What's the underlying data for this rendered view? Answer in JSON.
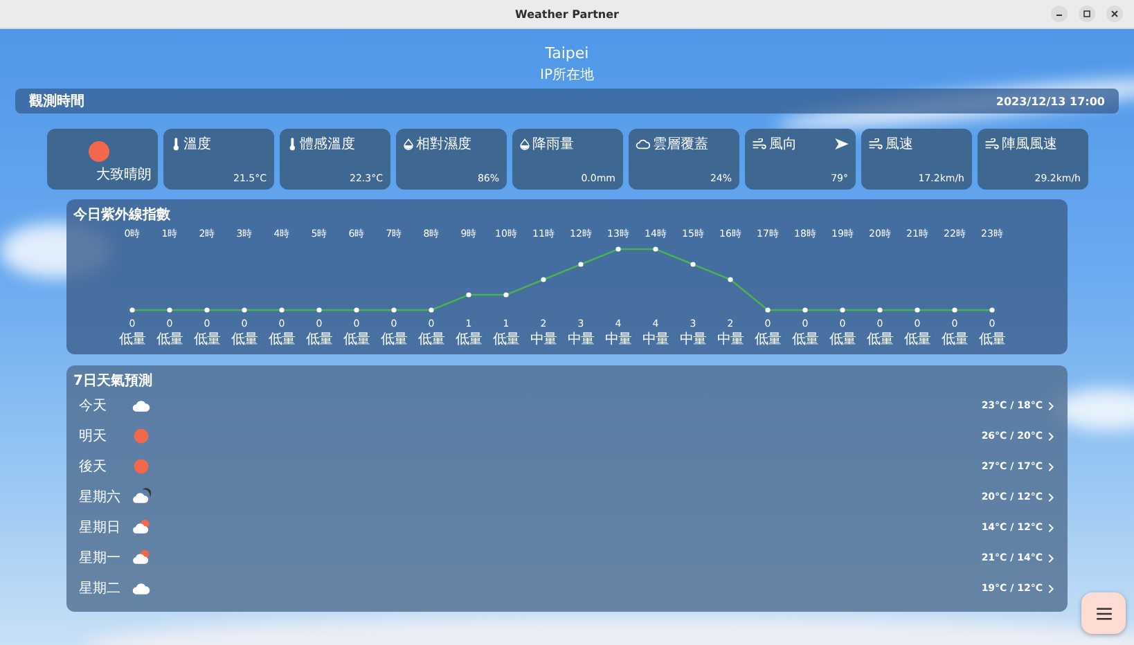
{
  "window": {
    "title": "Weather Partner"
  },
  "location": {
    "city": "Taipei",
    "source": "IP所在地"
  },
  "observation": {
    "label": "觀測時間",
    "time": "2023/12/13 17:00"
  },
  "cards": [
    {
      "kind": "condition",
      "text": "大致晴朗"
    },
    {
      "kind": "thermometer",
      "label": "溫度",
      "value": "21.5°C"
    },
    {
      "kind": "thermometer",
      "label": "體感溫度",
      "value": "22.3°C"
    },
    {
      "kind": "drop",
      "label": "相對濕度",
      "value": "86%"
    },
    {
      "kind": "drop",
      "label": "降雨量",
      "value": "0.0mm"
    },
    {
      "kind": "cloud",
      "label": "雲層覆蓋",
      "value": "24%"
    },
    {
      "kind": "wind",
      "label": "風向",
      "value": "79°",
      "direction_arrow": true
    },
    {
      "kind": "wind",
      "label": "風速",
      "value": "17.2km/h"
    },
    {
      "kind": "wind",
      "label": "陣風風速",
      "value": "29.2km/h"
    }
  ],
  "uv": {
    "chart_data": {
      "type": "line",
      "title": "今日紫外線指數",
      "categories": [
        "0時",
        "1時",
        "2時",
        "3時",
        "4時",
        "5時",
        "6時",
        "7時",
        "8時",
        "9時",
        "10時",
        "11時",
        "12時",
        "13時",
        "14時",
        "15時",
        "16時",
        "17時",
        "18時",
        "19時",
        "20時",
        "21時",
        "22時",
        "23時"
      ],
      "series": [
        {
          "color": "#4caf50",
          "marker": "circle",
          "values": [
            0,
            0,
            0,
            0,
            0,
            0,
            0,
            0,
            0,
            1,
            1,
            2,
            3,
            4,
            4,
            3,
            2,
            0,
            0,
            0,
            0,
            0,
            0,
            0
          ]
        }
      ],
      "data_labels": true
    },
    "risk_labels": [
      "低量",
      "低量",
      "低量",
      "低量",
      "低量",
      "低量",
      "低量",
      "低量",
      "低量",
      "低量",
      "低量",
      "中量",
      "中量",
      "中量",
      "中量",
      "中量",
      "中量",
      "低量",
      "低量",
      "低量",
      "低量",
      "低量",
      "低量",
      "低量"
    ]
  },
  "forecast": {
    "title": "7日天氣預測",
    "days": [
      {
        "day": "今天",
        "kind": "cloudy",
        "temps": "23°C / 18°C"
      },
      {
        "day": "明天",
        "kind": "sunny",
        "temps": "26°C / 20°C"
      },
      {
        "day": "後天",
        "kind": "sunny",
        "temps": "27°C / 17°C"
      },
      {
        "day": "星期六",
        "kind": "cloud_dark",
        "temps": "20°C / 12°C"
      },
      {
        "day": "星期日",
        "kind": "cloud_sun",
        "temps": "14°C / 12°C"
      },
      {
        "day": "星期一",
        "kind": "cloud_sun",
        "temps": "21°C / 14°C"
      },
      {
        "day": "星期二",
        "kind": "cloudy",
        "temps": "19°C / 12°C"
      }
    ]
  }
}
